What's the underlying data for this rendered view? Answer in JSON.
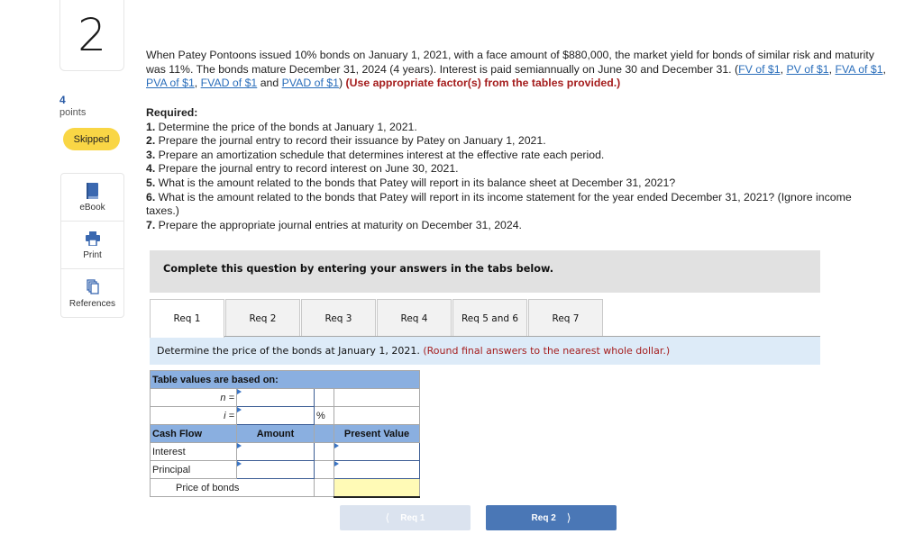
{
  "sidebar": {
    "question_number": "2",
    "points_value": "4",
    "points_label": "points",
    "status_badge": "Skipped",
    "tools": [
      {
        "label": "eBook",
        "icon": "book-icon"
      },
      {
        "label": "Print",
        "icon": "printer-icon"
      },
      {
        "label": "References",
        "icon": "documents-icon"
      }
    ]
  },
  "question": {
    "intro_text": "When Patey Pontoons issued 10% bonds on January 1, 2021, with a face amount of $880,000, the market yield for bonds of similar risk and maturity was 11%. The bonds mature December 31, 2024 (4 years). Interest is paid semiannually on June 30 and December 31. (",
    "links": [
      "FV of $1",
      "PV of $1",
      "FVA of $1",
      "PVA of $1",
      "FVAD of $1",
      "PVAD of $1"
    ],
    "link_separator": ", ",
    "link_and": " and ",
    "link_close": ") ",
    "emphasis": "(Use appropriate factor(s) from the tables provided.)",
    "required_heading": "Required:",
    "requirements": [
      {
        "num": "1.",
        "text": " Determine the price of the bonds at January 1, 2021."
      },
      {
        "num": "2.",
        "text": " Prepare the journal entry to record their issuance by Patey on January 1, 2021."
      },
      {
        "num": "3.",
        "text": " Prepare an amortization schedule that determines interest at the effective rate each period."
      },
      {
        "num": "4.",
        "text": " Prepare the journal entry to record interest on June 30, 2021."
      },
      {
        "num": "5.",
        "text": " What is the amount related to the bonds that Patey will report in its balance sheet at December 31, 2021?"
      },
      {
        "num": "6.",
        "text": " What is the amount related to the bonds that Patey will report in its income statement for the year ended December 31, 2021? (Ignore income taxes.)"
      },
      {
        "num": "7.",
        "text": " Prepare the appropriate journal entries at maturity on December 31, 2024."
      }
    ]
  },
  "instruction": "Complete this question by entering your answers in the tabs below.",
  "tabs": [
    {
      "label": "Req 1",
      "active": true
    },
    {
      "label": "Req 2",
      "active": false
    },
    {
      "label": "Req 3",
      "active": false
    },
    {
      "label": "Req 4",
      "active": false
    },
    {
      "label": "Req 5 and 6",
      "active": false
    },
    {
      "label": "Req 7",
      "active": false
    }
  ],
  "task": {
    "text": "Determine the price of the bonds at January 1, 2021. ",
    "note": "(Round final answers to the nearest whole dollar.)"
  },
  "worksheet": {
    "title": "Table values are based on:",
    "n_label": "n =",
    "i_label": "i =",
    "percent": "%",
    "n_value": "",
    "i_value": "",
    "col_cash_flow": "Cash Flow",
    "col_amount": "Amount",
    "col_present_value": "Present Value",
    "rows": [
      {
        "label": "Interest",
        "amount": "",
        "present_value": ""
      },
      {
        "label": "Principal",
        "amount": "",
        "present_value": ""
      }
    ],
    "total_label": "Price of bonds",
    "total_value": ""
  },
  "nav": {
    "prev_label": "Req 1",
    "next_label": "Req 2",
    "prev_icon": "chevron-left-icon",
    "next_icon": "chevron-right-icon"
  }
}
